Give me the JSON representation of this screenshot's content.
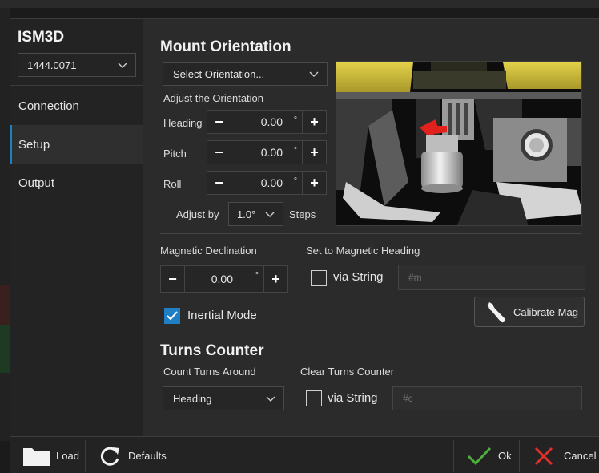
{
  "app": {
    "title": "ISM3D",
    "serial": "1444.0071"
  },
  "nav": [
    {
      "label": "Connection"
    },
    {
      "label": "Setup"
    },
    {
      "label": "Output"
    }
  ],
  "mount": {
    "title": "Mount Orientation",
    "select_label": "Select Orientation...",
    "adjust_label": "Adjust the Orientation",
    "heading": {
      "label": "Heading",
      "value": "0.00",
      "unit": "°"
    },
    "pitch": {
      "label": "Pitch",
      "value": "0.00",
      "unit": "°"
    },
    "roll": {
      "label": "Roll",
      "value": "0.00",
      "unit": "°"
    },
    "adjust_by_label": "Adjust by",
    "adjust_by_value": "1.0°",
    "steps_label": "Steps"
  },
  "magnetic": {
    "declination_label": "Magnetic Declination",
    "declination_value": "0.00",
    "declination_unit": "°",
    "set_heading_label": "Set to Magnetic Heading",
    "via_string_label": "via String",
    "via_string_checked": false,
    "string_placeholder": "#m",
    "inertial_label": "Inertial Mode",
    "inertial_checked": true,
    "calibrate_label": "Calibrate Mag"
  },
  "turns": {
    "title": "Turns Counter",
    "count_label": "Count Turns Around",
    "count_value": "Heading",
    "clear_label": "Clear Turns Counter",
    "via_string_label": "via String",
    "via_string_checked": false,
    "string_placeholder": "#c"
  },
  "footer": {
    "load": "Load",
    "defaults": "Defaults",
    "ok": "Ok",
    "cancel": "Cancel"
  },
  "colors": {
    "accent": "#1f7fc4",
    "ok": "#4caf3a",
    "cancel": "#e0302a",
    "yellow": "#d9c640"
  }
}
